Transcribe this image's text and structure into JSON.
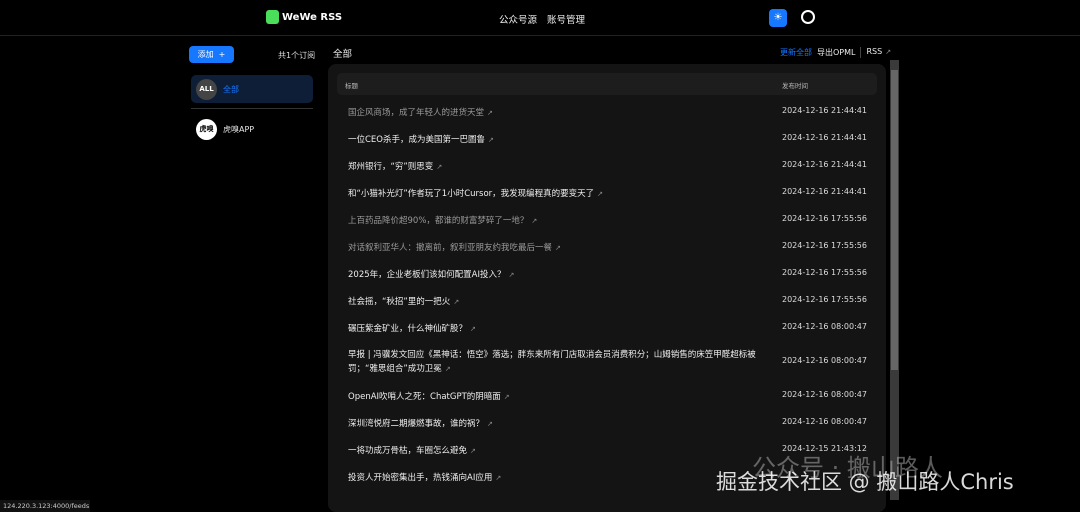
{
  "header": {
    "app_name": "WeWe RSS",
    "nav": [
      "公众号源",
      "账号管理"
    ],
    "theme_icon": "☀"
  },
  "sidebar": {
    "add_label": "添加",
    "add_icon": "+",
    "count_label": "共1个订阅",
    "items": [
      {
        "avatar": "ALL",
        "label": "全部",
        "active": true
      },
      {
        "avatar": "虎嗅",
        "label": "虎嗅APP",
        "active": false
      }
    ]
  },
  "main": {
    "title": "全部",
    "actions": {
      "update_all": "更新全部",
      "export_opml": "导出OPML",
      "rss": "RSS"
    },
    "columns": {
      "title": "标题",
      "date": "发布时间"
    },
    "rows": [
      {
        "title": "国企风商场，成了年轻人的进货天堂",
        "date": "2024-12-16 21:44:41",
        "visited": true
      },
      {
        "title": "一位CEO杀手，成为美国第一巴圖鲁",
        "date": "2024-12-16 21:44:41",
        "visited": false
      },
      {
        "title": "郑州银行，“穷”则思变",
        "date": "2024-12-16 21:44:41",
        "visited": false
      },
      {
        "title": "和“小猫补光灯”作者玩了1小时Cursor，我发现编程真的要变天了",
        "date": "2024-12-16 21:44:41",
        "visited": false
      },
      {
        "title": "上百药品降价超90%，都谁的财富梦碎了一地？",
        "date": "2024-12-16 17:55:56",
        "visited": true
      },
      {
        "title": "对话叙利亚华人：撤离前，叙利亚朋友约我吃最后一餐",
        "date": "2024-12-16 17:55:56",
        "visited": true
      },
      {
        "title": "2025年，企业老板们该如何配置AI投入？",
        "date": "2024-12-16 17:55:56",
        "visited": false
      },
      {
        "title": "社会摇，“秋招”里的一把火",
        "date": "2024-12-16 17:55:56",
        "visited": false
      },
      {
        "title": "碾压紫金矿业，什么神仙矿股？",
        "date": "2024-12-16 08:00:47",
        "visited": false
      },
      {
        "title": "早报 | 冯骥发文回应《黑神话：悟空》落选；胖东来所有门店取消会员消费积分；山姆销售的床笠甲醛超标被罚；“雅思组合”成功卫冕",
        "date": "2024-12-16 08:00:47",
        "visited": false
      },
      {
        "title": "OpenAI吹哨人之死：ChatGPT的阴暗面",
        "date": "2024-12-16 08:00:47",
        "visited": false
      },
      {
        "title": "深圳湾悦府二期爆燃事故，谁的祸？",
        "date": "2024-12-16 08:00:47",
        "visited": false
      },
      {
        "title": "一将功成万骨枯，车圈怎么避免",
        "date": "2024-12-15 21:43:12",
        "visited": false
      },
      {
        "title": "投资人开始密集出手，热钱涌向AI应用",
        "date": "",
        "visited": false
      }
    ]
  },
  "status_url": "124.220.3.123:4000/feeds",
  "watermark": {
    "line1": "公众号 · 搬山路人",
    "line2": "掘金技术社区 @ 搬山路人Chris"
  }
}
